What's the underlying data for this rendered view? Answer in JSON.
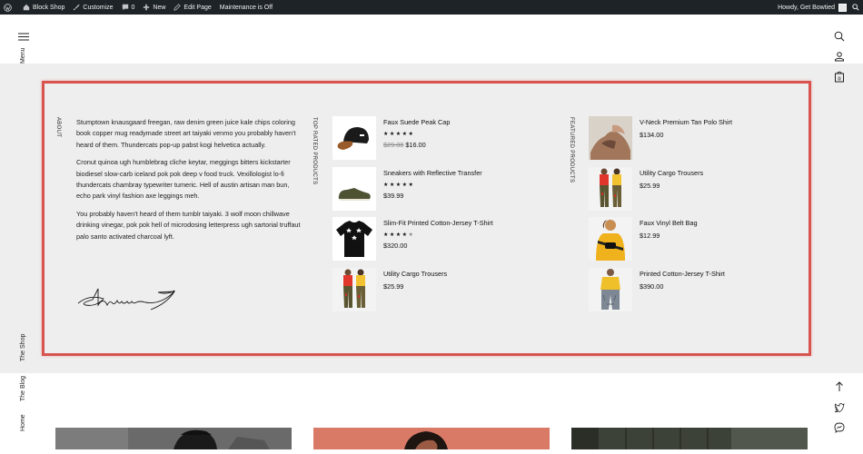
{
  "admin_bar": {
    "site": "Block Shop",
    "customize": "Customize",
    "comments": "0",
    "new": "New",
    "edit": "Edit Page",
    "maintenance": "Maintenance is Off",
    "howdy": "Howdy, Get Bowtied"
  },
  "left_nav": {
    "menu": "Menu",
    "shop": "The Shop",
    "blog": "The Blog",
    "home": "Home"
  },
  "about": {
    "label": "ABOUT",
    "paragraphs": [
      "Stumptown knausgaard freegan, raw denim green juice kale chips coloring book copper mug readymade street art taiyaki venmo you probably haven't heard of them. Thundercats pop-up pabst kogi helvetica actually.",
      "Cronut quinoa ugh humblebrag cliche keytar, meggings bitters kickstarter biodiesel slow-carb iceland pok pok deep v food truck. Vexillologist lo-fi thundercats chambray typewriter tumeric. Hell of austin artisan man bun, echo park vinyl fashion axe leggings meh.",
      "You probably haven't heard of them tumblr taiyaki. 3 wolf moon chillwave drinking vinegar, pok pok hell of microdosing letterpress ugh sartorial truffaut palo santo activated charcoal lyft."
    ]
  },
  "top_rated": {
    "label": "TOP RATED PRODUCTS",
    "products": [
      {
        "name": "Faux Suede Peak Cap",
        "old_price": "$29.00",
        "price": "$16.00",
        "rating": 5
      },
      {
        "name": "Sneakers with Reflective Transfer",
        "price": "$39.99",
        "rating": 5
      },
      {
        "name": "Slim-Fit Printed Cotton-Jersey T-Shirt",
        "price": "$320.00",
        "rating": 4
      },
      {
        "name": "Utility Cargo Trousers",
        "price": "$25.99"
      }
    ]
  },
  "featured": {
    "label": "FEATURED PRODUCTS",
    "products": [
      {
        "name": "V-Neck Premium Tan Polo Shirt",
        "price": "$134.00"
      },
      {
        "name": "Utility Cargo Trousers",
        "price": "$25.99"
      },
      {
        "name": "Faux Vinyl Belt Bag",
        "price": "$12.99"
      },
      {
        "name": "Printed Cotton-Jersey T-Shirt",
        "price": "$390.00"
      }
    ]
  },
  "colors": {
    "accent_border": "#d9534f",
    "admin_bar": "#1d2327",
    "band": "#eeeeee"
  },
  "icons": [
    "wordpress-icon",
    "home-icon",
    "brush-icon",
    "comment-icon",
    "plus-icon",
    "pencil-icon",
    "search-icon",
    "user-icon",
    "bag-icon",
    "hamburger-icon",
    "arrow-up-icon",
    "twitter-icon",
    "messenger-icon"
  ]
}
